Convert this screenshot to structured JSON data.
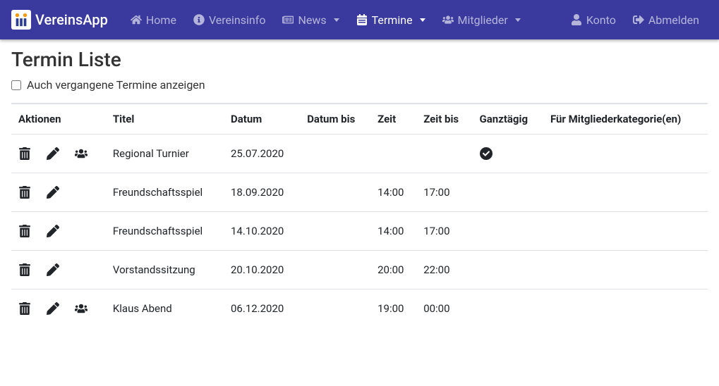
{
  "brand": "VereinsApp",
  "nav": {
    "home": "Home",
    "vereinsinfo": "Vereinsinfo",
    "news": "News",
    "termine": "Termine",
    "mitglieder": "Mitglieder",
    "konto": "Konto",
    "abmelden": "Abmelden"
  },
  "page": {
    "title": "Termin Liste",
    "checkbox_label": "Auch vergangene Termine anzeigen"
  },
  "columns": {
    "aktionen": "Aktionen",
    "titel": "Titel",
    "datum": "Datum",
    "datum_bis": "Datum bis",
    "zeit": "Zeit",
    "zeit_bis": "Zeit bis",
    "ganztaegig": "Ganztägig",
    "kategorien": "Für Mitgliederkategorie(en)"
  },
  "rows": [
    {
      "titel": "Regional Turnier",
      "datum": "25.07.2020",
      "datum_bis": "",
      "zeit": "",
      "zeit_bis": "",
      "ganztaegig": true,
      "kategorien": "",
      "has_members": true
    },
    {
      "titel": "Freundschaftsspiel",
      "datum": "18.09.2020",
      "datum_bis": "",
      "zeit": "14:00",
      "zeit_bis": "17:00",
      "ganztaegig": false,
      "kategorien": "",
      "has_members": false
    },
    {
      "titel": "Freundschaftsspiel",
      "datum": "14.10.2020",
      "datum_bis": "",
      "zeit": "14:00",
      "zeit_bis": "17:00",
      "ganztaegig": false,
      "kategorien": "",
      "has_members": false
    },
    {
      "titel": "Vorstandssitzung",
      "datum": "20.10.2020",
      "datum_bis": "",
      "zeit": "20:00",
      "zeit_bis": "22:00",
      "ganztaegig": false,
      "kategorien": "",
      "has_members": false
    },
    {
      "titel": "Klaus Abend",
      "datum": "06.12.2020",
      "datum_bis": "",
      "zeit": "19:00",
      "zeit_bis": "00:00",
      "ganztaegig": false,
      "kategorien": "",
      "has_members": true
    }
  ]
}
